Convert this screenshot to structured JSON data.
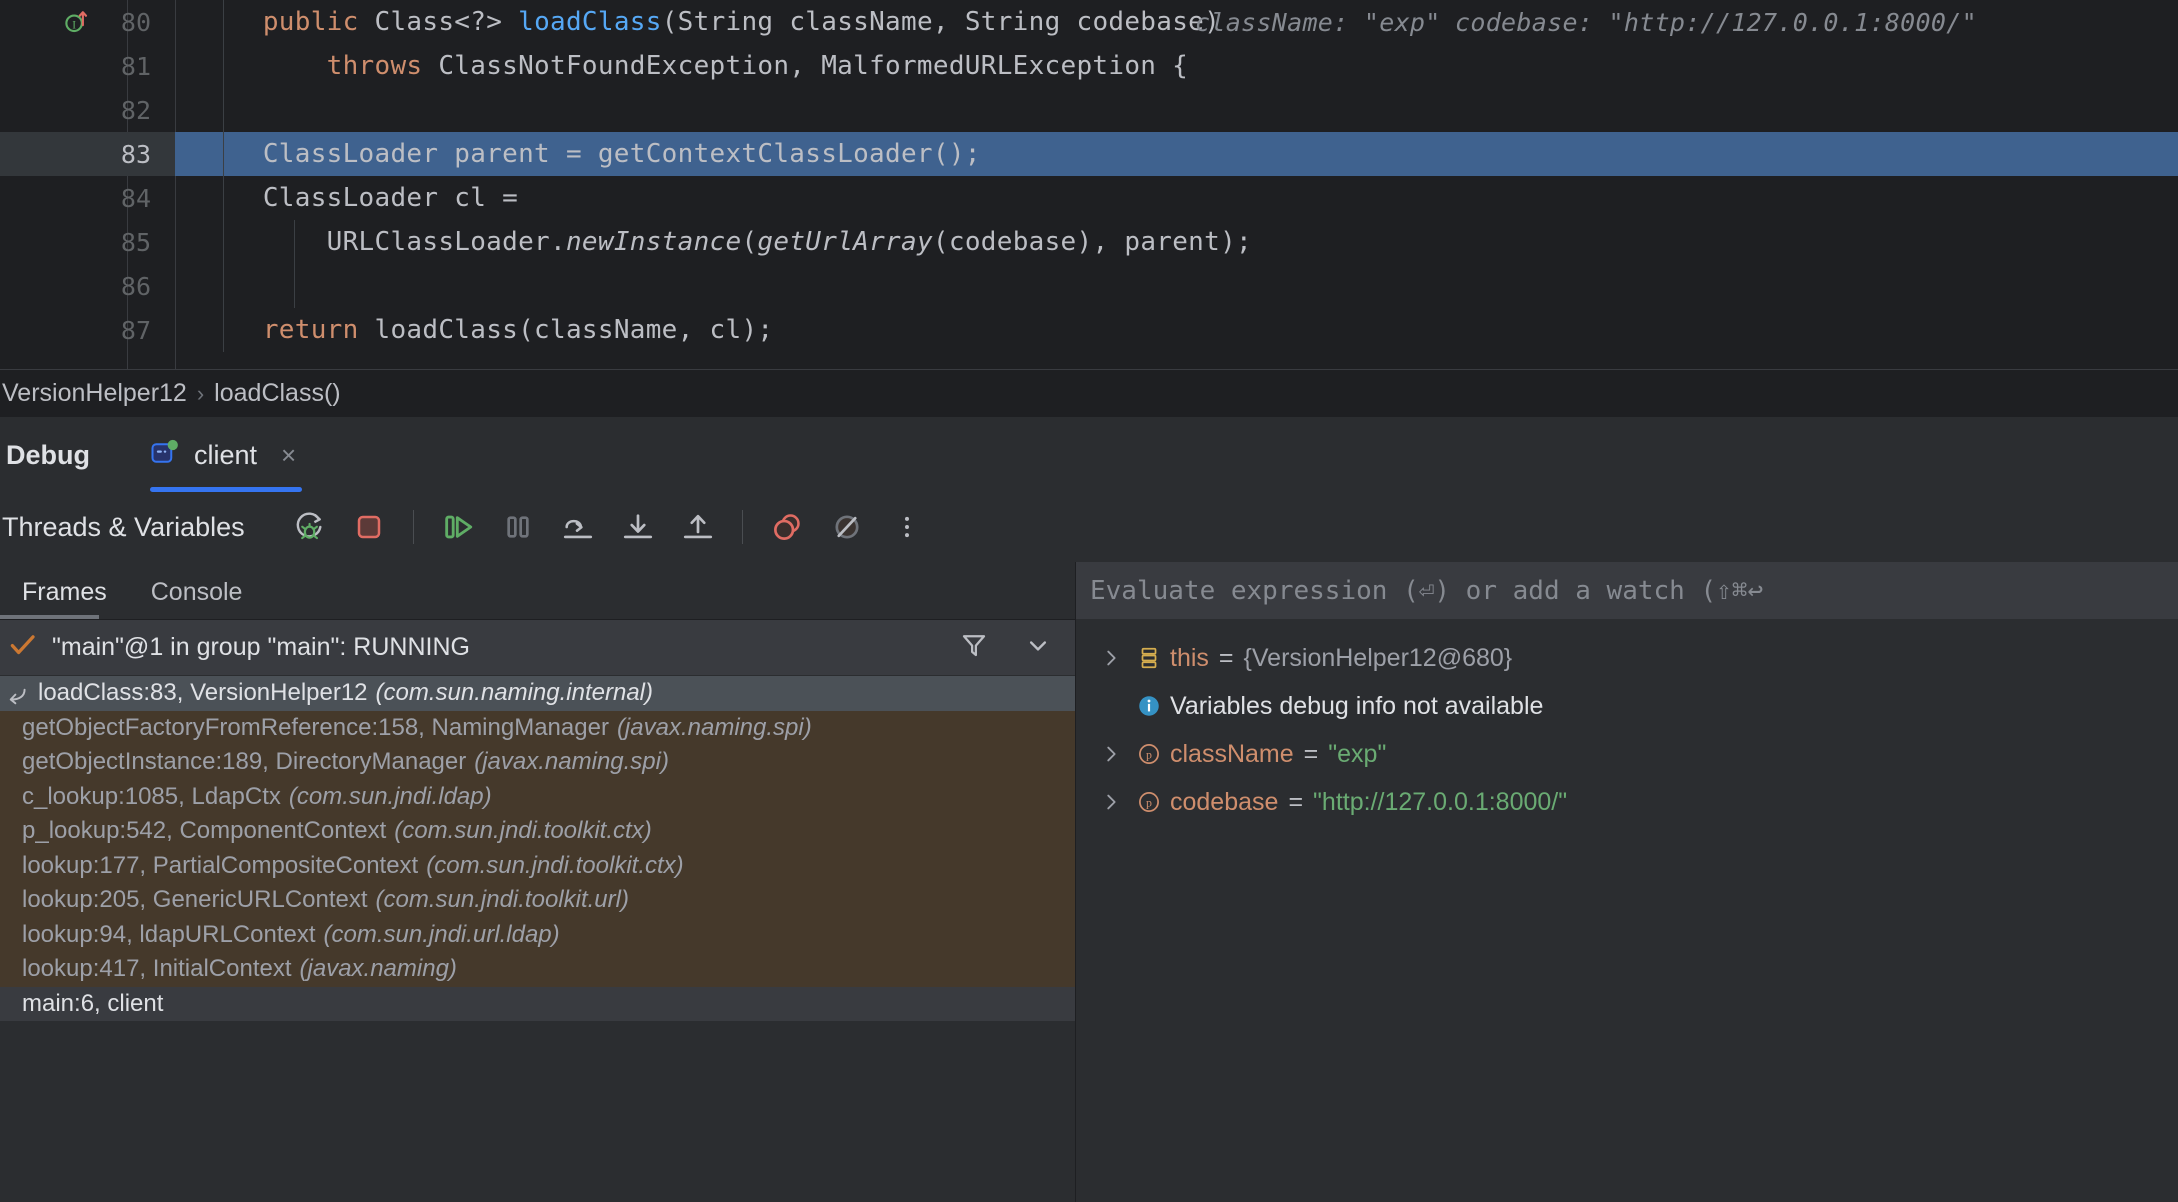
{
  "editor": {
    "lines": [
      {
        "num": "80",
        "has_gutter_icon": true,
        "indent": 1,
        "segments": [
          {
            "t": "public ",
            "c": "kw"
          },
          {
            "t": "Class<?> ",
            "c": "plain"
          },
          {
            "t": "loadClass",
            "c": "meth"
          },
          {
            "t": "(String className, String codebase)",
            "c": "plain"
          }
        ],
        "hints": [
          {
            "text": "className: \"exp\"",
            "offset": 1020
          },
          {
            "text": "codebase: \"http://127.0.0.1:8000/\"",
            "offset": 1280
          }
        ]
      },
      {
        "num": "81",
        "indent": 2,
        "segments": [
          {
            "t": "throws ",
            "c": "kw"
          },
          {
            "t": "ClassNotFoundException, MalformedURLException {",
            "c": "plain"
          }
        ],
        "hints": []
      },
      {
        "num": "82",
        "segments": [],
        "hints": []
      },
      {
        "num": "83",
        "current": true,
        "indent": 1,
        "segments": [
          {
            "t": "ClassLoader parent = getContextClassLoader();",
            "c": "plain"
          }
        ],
        "hints": []
      },
      {
        "num": "84",
        "indent": 1,
        "segments": [
          {
            "t": "ClassLoader cl =",
            "c": "plain"
          }
        ],
        "hints": []
      },
      {
        "num": "85",
        "indent": 2,
        "segments": [
          {
            "t": "URLClassLoader.",
            "c": "plain"
          },
          {
            "t": "newInstance",
            "c": "ital"
          },
          {
            "t": "(",
            "c": "plain"
          },
          {
            "t": "getUrlArray",
            "c": "ital"
          },
          {
            "t": "(codebase), parent);",
            "c": "plain"
          }
        ],
        "hints": []
      },
      {
        "num": "86",
        "segments": [],
        "hints": []
      },
      {
        "num": "87",
        "indent": 1,
        "segments": [
          {
            "t": "return ",
            "c": "kw"
          },
          {
            "t": "loadClass(className, cl);",
            "c": "plain"
          }
        ],
        "hints": []
      }
    ]
  },
  "breadcrumb": {
    "class": "VersionHelper12",
    "separator": "›",
    "method": "loadClass()"
  },
  "debug": {
    "title": "Debug",
    "tab": {
      "label": "client",
      "close": "×"
    },
    "toolbar": {
      "label": "Threads & Variables",
      "buttons": [
        {
          "name": "rerun-debug-button",
          "title": "Rerun"
        },
        {
          "name": "stop-button",
          "title": "Stop"
        },
        {
          "name": "resume-program-button",
          "title": "Resume Program"
        },
        {
          "name": "pause-program-button",
          "title": "Pause Program"
        },
        {
          "name": "step-over-button",
          "title": "Step Over"
        },
        {
          "name": "step-into-button",
          "title": "Step Into"
        },
        {
          "name": "step-out-button",
          "title": "Step Out"
        },
        {
          "name": "view-breakpoints-button",
          "title": "View Breakpoints"
        },
        {
          "name": "mute-breakpoints-button",
          "title": "Mute Breakpoints"
        },
        {
          "name": "more-options-button",
          "title": "More"
        }
      ]
    },
    "subtabs": [
      {
        "label": "Frames",
        "active": true
      },
      {
        "label": "Console",
        "active": false
      }
    ],
    "thread": {
      "label": "\"main\"@1 in group \"main\": RUNNING"
    },
    "frames": [
      {
        "method": "loadClass:83, VersionHelper12",
        "pkg": "(com.sun.naming.internal)",
        "state": "selected"
      },
      {
        "method": "getObjectFactoryFromReference:158, NamingManager",
        "pkg": "(javax.naming.spi)",
        "state": "lib"
      },
      {
        "method": "getObjectInstance:189, DirectoryManager",
        "pkg": "(javax.naming.spi)",
        "state": "lib"
      },
      {
        "method": "c_lookup:1085, LdapCtx",
        "pkg": "(com.sun.jndi.ldap)",
        "state": "lib"
      },
      {
        "method": "p_lookup:542, ComponentContext",
        "pkg": "(com.sun.jndi.toolkit.ctx)",
        "state": "lib"
      },
      {
        "method": "lookup:177, PartialCompositeContext",
        "pkg": "(com.sun.jndi.toolkit.ctx)",
        "state": "lib"
      },
      {
        "method": "lookup:205, GenericURLContext",
        "pkg": "(com.sun.jndi.toolkit.url)",
        "state": "lib"
      },
      {
        "method": "lookup:94, ldapURLContext",
        "pkg": "(com.sun.jndi.url.ldap)",
        "state": "lib"
      },
      {
        "method": "lookup:417, InitialContext",
        "pkg": "(javax.naming)",
        "state": "lib"
      },
      {
        "method": "main:6, client",
        "pkg": "",
        "state": "user"
      }
    ],
    "evaluate": {
      "placeholder": "Evaluate expression (⏎) or add a watch (⇧⌘↩"
    },
    "variables": [
      {
        "kind": "object",
        "expandable": true,
        "icon": "object-icon",
        "name": "this",
        "eq": "=",
        "value": "{VersionHelper12@680}",
        "value_type": "obj"
      },
      {
        "kind": "info",
        "expandable": false,
        "icon": "info-icon",
        "name": "",
        "eq": "",
        "value": "Variables debug info not available",
        "value_type": "info"
      },
      {
        "kind": "param",
        "expandable": true,
        "icon": "parameter-icon",
        "name": "className",
        "eq": "=",
        "value": "\"exp\"",
        "value_type": "str"
      },
      {
        "kind": "param",
        "expandable": true,
        "icon": "parameter-icon",
        "name": "codebase",
        "eq": "=",
        "value": "\"http://127.0.0.1:8000/\"",
        "value_type": "str"
      }
    ]
  },
  "colors": {
    "editor_bg": "#1e1f22",
    "panel_bg": "#2b2d30",
    "current_line": "#3f628f",
    "lib_frame_bg": "#45392b",
    "accent": "#3574f0",
    "string_green": "#6aab73",
    "keyword_orange": "#cf8e6d",
    "method_blue": "#56a8f5"
  }
}
